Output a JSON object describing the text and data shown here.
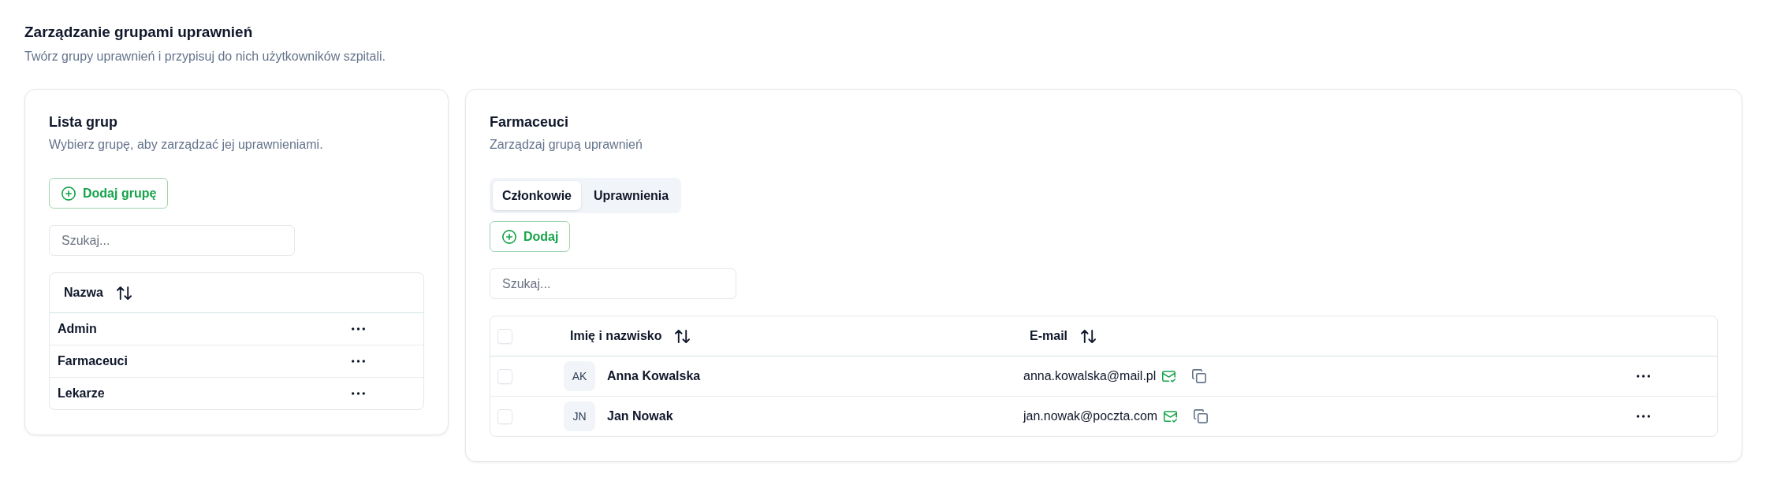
{
  "header": {
    "title": "Zarządzanie grupami uprawnień",
    "subtitle": "Twórz grupy uprawnień i przypisuj do nich użytkowników szpitali."
  },
  "groups_panel": {
    "title": "Lista grup",
    "subtitle": "Wybierz grupę, aby zarządzać jej uprawnieniami.",
    "add_button": "Dodaj grupę",
    "search": {
      "placeholder": "Szukaj..."
    },
    "table": {
      "columns": [
        "Nazwa"
      ],
      "rows": [
        {
          "name": "Admin"
        },
        {
          "name": "Farmaceuci"
        },
        {
          "name": "Lekarze"
        }
      ]
    }
  },
  "detail_panel": {
    "title": "Farmaceuci",
    "subtitle": "Zarządzaj grupą uprawnień",
    "tabs": [
      {
        "label": "Członkowie",
        "selected": true
      },
      {
        "label": "Uprawnienia",
        "selected": false
      }
    ],
    "add_button": "Dodaj",
    "search": {
      "placeholder": "Szukaj..."
    },
    "table": {
      "all_checked": false,
      "columns": [
        "Imię i nazwisko",
        "E-mail"
      ],
      "rows": [
        {
          "checked": false,
          "initials": "AK",
          "name": "Anna Kowalska",
          "email": "anna.kowalska@mail.pl",
          "email_verified": true
        },
        {
          "checked": false,
          "initials": "JN",
          "name": "Jan Nowak",
          "email": "jan.nowak@poczta.com",
          "email_verified": true
        }
      ]
    }
  }
}
